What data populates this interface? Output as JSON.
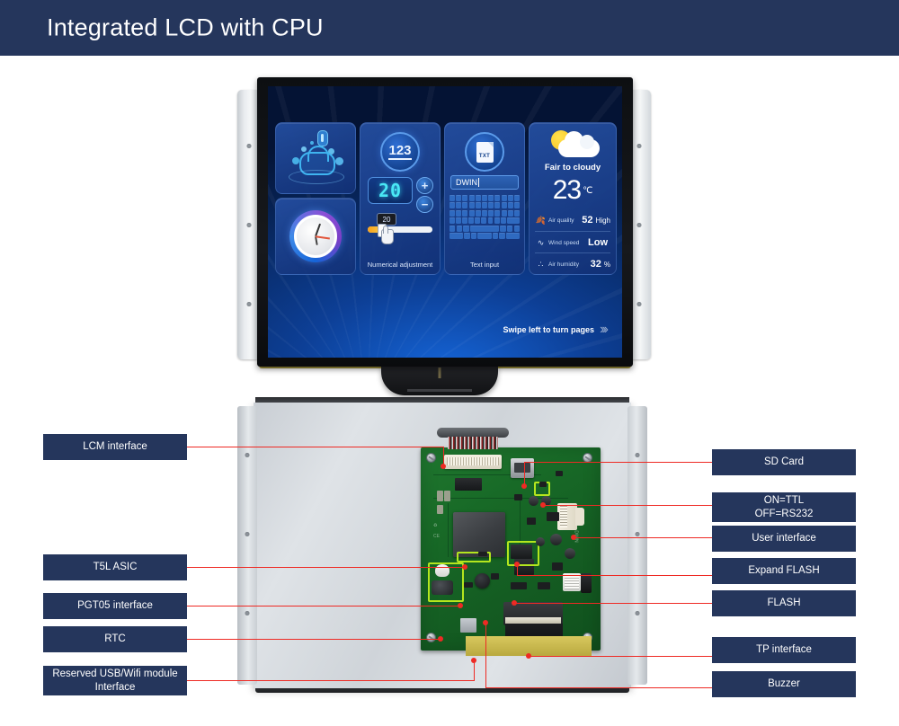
{
  "header": {
    "title": "Integrated LCD with CPU"
  },
  "screen": {
    "cards": {
      "cloud": {
        "icon": "cloud-icon"
      },
      "clock": {
        "icon": "clock-gauge-icon"
      },
      "numeric": {
        "badge": "123",
        "value": "20",
        "plus": "+",
        "minus": "−",
        "slider_value": "20",
        "caption": "Numerical adjustment"
      },
      "text": {
        "icon_label": "TXT",
        "input_value": "DWIN",
        "caption": "Text input"
      },
      "weather": {
        "condition": "Fair to cloudy",
        "temperature": "23",
        "temperature_unit": "℃",
        "rows": [
          {
            "icon": "leaf-icon",
            "label": "Air quality",
            "value": "52",
            "suffix": "High"
          },
          {
            "icon": "wind-icon",
            "label": "Wind speed",
            "value": "Low",
            "suffix": ""
          },
          {
            "icon": "humidity-icon",
            "label": "Air humidity",
            "value": "32",
            "suffix": "%"
          }
        ]
      }
    },
    "swipe_hint": "Swipe left to turn pages",
    "swipe_chevrons": "›››"
  },
  "callouts": {
    "left": [
      {
        "id": "lcm-interface",
        "label": "LCM interface"
      },
      {
        "id": "t5l-asic",
        "label": "T5L ASIC"
      },
      {
        "id": "pgt05-interface",
        "label": "PGT05 interface"
      },
      {
        "id": "rtc",
        "label": "RTC"
      },
      {
        "id": "reserved-usb-wifi",
        "label": "Reserved USB/Wifi module Interface"
      }
    ],
    "right": [
      {
        "id": "sd-card",
        "label": "SD Card"
      },
      {
        "id": "ttl-rs232",
        "label": "ON=TTL\nOFF=RS232"
      },
      {
        "id": "user-interface",
        "label": "User interface"
      },
      {
        "id": "expand-flash",
        "label": "Expand FLASH"
      },
      {
        "id": "flash",
        "label": "FLASH"
      },
      {
        "id": "tp-interface",
        "label": "TP interface"
      },
      {
        "id": "buzzer",
        "label": "Buzzer"
      }
    ]
  },
  "colors": {
    "header_bg": "#25365c",
    "label_bg": "#25365c",
    "lead_line": "#ee2a24",
    "screen_blue": "#1565d8",
    "pcb_green": "#20772f",
    "accent_cyan": "#49e8f5"
  }
}
